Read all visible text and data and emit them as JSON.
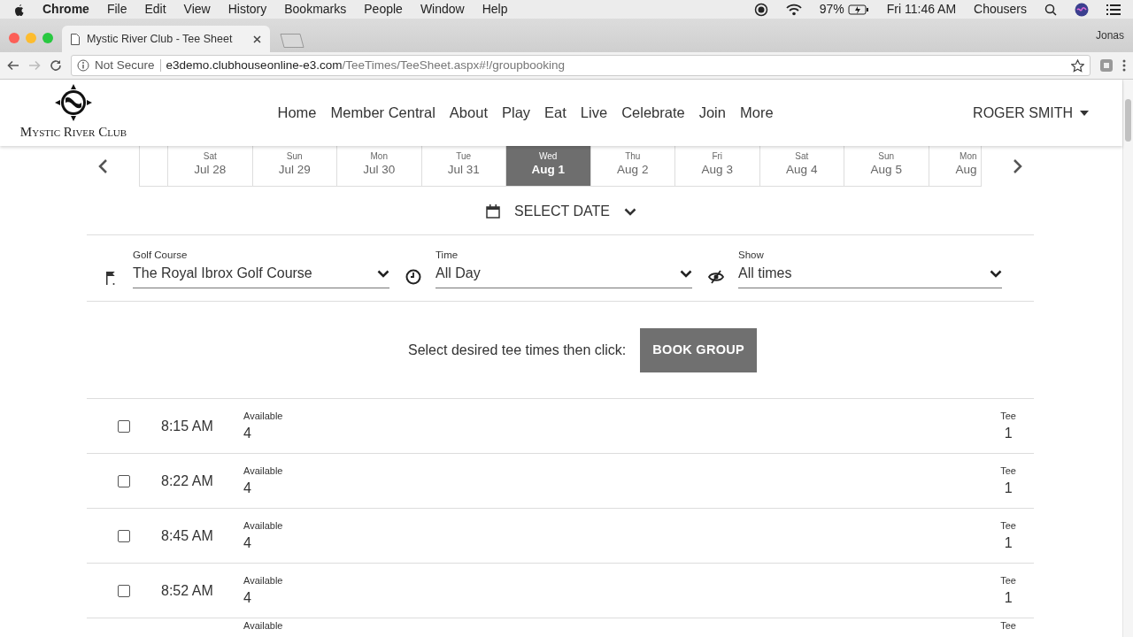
{
  "menu_bar": {
    "app": "Chrome",
    "items": [
      "File",
      "Edit",
      "View",
      "History",
      "Bookmarks",
      "People",
      "Window",
      "Help"
    ],
    "battery": "97%",
    "clock": "Fri 11:46 AM",
    "user": "Chousers"
  },
  "browser": {
    "tab_title": "Mystic River Club - Tee Sheet",
    "profile": "Jonas",
    "security": "Not Secure",
    "url_host": "e3demo.clubhouseonline-e3.com",
    "url_path": "/TeeTimes/TeeSheet.aspx#!/groupbooking"
  },
  "site": {
    "logo_text": "Mystic River Club",
    "nav": [
      "Home",
      "Member Central",
      "About",
      "Play",
      "Eat",
      "Live",
      "Celebrate",
      "Join",
      "More"
    ],
    "user_menu": "ROGER SMITH"
  },
  "dates": [
    {
      "day": "Sat",
      "date": "Jul 28",
      "selected": false
    },
    {
      "day": "Sun",
      "date": "Jul 29",
      "selected": false
    },
    {
      "day": "Mon",
      "date": "Jul 30",
      "selected": false
    },
    {
      "day": "Tue",
      "date": "Jul 31",
      "selected": false
    },
    {
      "day": "Wed",
      "date": "Aug 1",
      "selected": true
    },
    {
      "day": "Thu",
      "date": "Aug 2",
      "selected": false
    },
    {
      "day": "Fri",
      "date": "Aug 3",
      "selected": false
    },
    {
      "day": "Sat",
      "date": "Aug 4",
      "selected": false
    },
    {
      "day": "Sun",
      "date": "Aug 5",
      "selected": false
    },
    {
      "day": "Mon",
      "date": "Aug",
      "selected": false
    }
  ],
  "select_date": "SELECT DATE",
  "filters": [
    {
      "kind": "flag",
      "label": "Golf Course",
      "value": "The Royal Ibrox Golf Course"
    },
    {
      "kind": "clock",
      "label": "Time",
      "value": "All Day"
    },
    {
      "kind": "eye",
      "label": "Show",
      "value": "All times"
    }
  ],
  "prompt": "Select desired tee times then click:",
  "book_button": "BOOK GROUP",
  "tee_times": [
    {
      "time": "8:15 AM",
      "available_label": "Available",
      "available": "4",
      "tee_label": "Tee",
      "tee": "1",
      "checked": false
    },
    {
      "time": "8:22 AM",
      "available_label": "Available",
      "available": "4",
      "tee_label": "Tee",
      "tee": "1",
      "checked": false
    },
    {
      "time": "8:45 AM",
      "available_label": "Available",
      "available": "4",
      "tee_label": "Tee",
      "tee": "1",
      "checked": false
    },
    {
      "time": "8:52 AM",
      "available_label": "Available",
      "available": "4",
      "tee_label": "Tee",
      "tee": "1",
      "checked": false
    }
  ],
  "partial_row": {
    "available_label": "Available",
    "tee_label": "Tee"
  }
}
